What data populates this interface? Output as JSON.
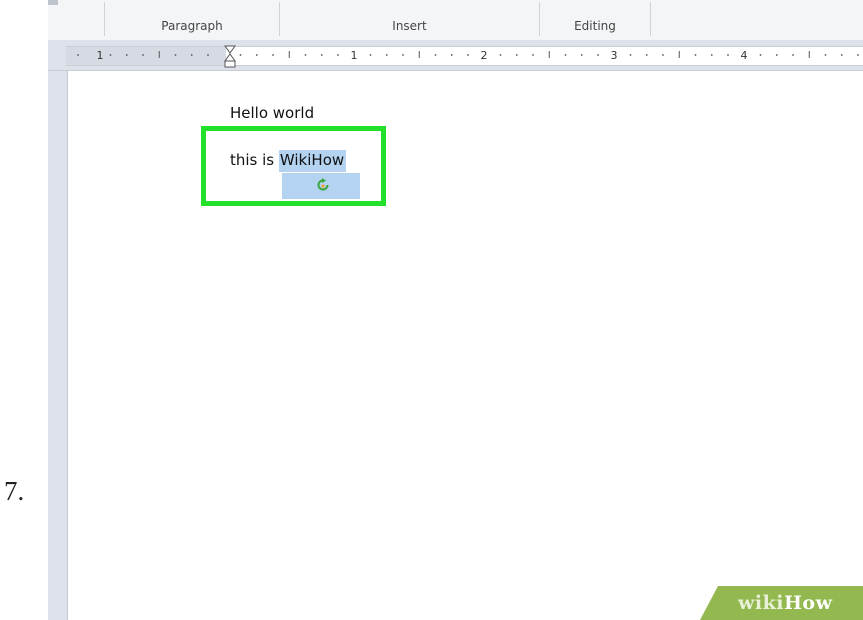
{
  "step": {
    "number": "7."
  },
  "ribbon": {
    "groups": [
      {
        "label": "Paragraph"
      },
      {
        "label": "Insert"
      },
      {
        "label": "Editing"
      }
    ]
  },
  "ruler": {
    "numbers": [
      "1",
      "1",
      "2",
      "3",
      "4"
    ]
  },
  "document": {
    "line1": "Hello world",
    "line2_plain": "this is ",
    "line2_selected": "WikiHow",
    "selection_color": "#b3d3f1",
    "highlight_color": "#23e02a",
    "paste_icon": "paste-options-icon"
  },
  "watermark": {
    "part1": "wiki",
    "part2": "How",
    "color": "#92b84f"
  }
}
